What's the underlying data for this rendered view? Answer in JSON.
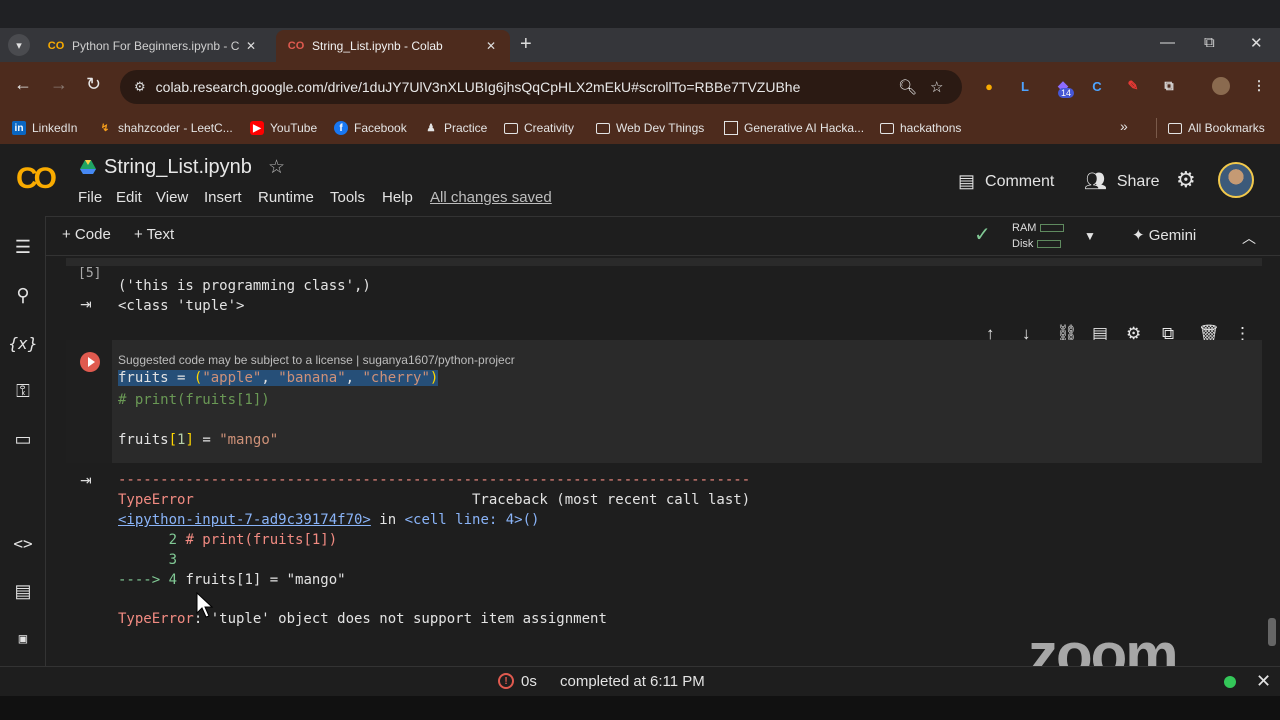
{
  "browser": {
    "tabs": [
      {
        "title": "Python For Beginners.ipynb - C",
        "active": false
      },
      {
        "title": "String_List.ipynb - Colab",
        "active": true
      }
    ],
    "new_tab": "+",
    "window_controls": {
      "minimize": "—",
      "restore": "⧉",
      "close": "✕"
    },
    "url": "colab.research.google.com/drive/1duJY7UlV3nXLUBIg6jhsQqCpHLX2mEkU#scrollTo=RBBe7TVZUBhe",
    "extensions_badge": "14",
    "bookmarks": [
      {
        "label": "LinkedIn",
        "icon": "linkedin-icon"
      },
      {
        "label": "shahzcoder - LeetC...",
        "icon": "leetcode-icon"
      },
      {
        "label": "YouTube",
        "icon": "youtube-icon"
      },
      {
        "label": "Facebook",
        "icon": "facebook-icon"
      },
      {
        "label": "Practice",
        "icon": "practice-icon"
      },
      {
        "label": "Creativity",
        "icon": "folder-icon"
      },
      {
        "label": "Web Dev Things",
        "icon": "folder-icon"
      },
      {
        "label": "Generative AI Hacka...",
        "icon": "page-icon"
      },
      {
        "label": "hackathons",
        "icon": "folder-icon"
      }
    ],
    "more_bookmarks": "»",
    "all_bookmarks": "All Bookmarks"
  },
  "colab": {
    "notebook_title": "String_List.ipynb",
    "menu": [
      "File",
      "Edit",
      "View",
      "Insert",
      "Runtime",
      "Tools",
      "Help"
    ],
    "save_status": "All changes saved",
    "comment_label": "Comment",
    "share_label": "Share",
    "toolbar": {
      "add_code": "+ Code",
      "add_text": "+ Text",
      "ram_label": "RAM",
      "disk_label": "Disk",
      "gemini_label": "Gemini"
    },
    "rail_icons": [
      "toc-icon",
      "search-icon",
      "variables-icon",
      "key-icon",
      "folder-icon",
      "code-snippets-icon",
      "command-palette-icon",
      "terminal-icon"
    ]
  },
  "cells": {
    "prev_output": {
      "exec_count": "[5]",
      "lines": [
        "('this is programming class',)",
        "<class 'tuple'>"
      ]
    },
    "active_cell": {
      "license_notice": "Suggested code may be subject to a license | suganya1607/python-projecr",
      "line1": {
        "var": "fruits",
        "op": " = ",
        "open": "(",
        "s1": "\"apple\"",
        "c1": ", ",
        "s2": "\"banana\"",
        "c2": ", ",
        "s3": "\"cherry\"",
        "close": ")"
      },
      "line2": "# print(fruits[1])",
      "line4": {
        "var": "fruits",
        "open": "[",
        "idx": "1",
        "close": "]",
        "op": " = ",
        "val": "\"mango\""
      }
    },
    "error_output": {
      "dashes": "---------------------------------------------------------------------------",
      "error_name": "TypeError",
      "traceback_label": "Traceback (most recent call last)",
      "link": "<ipython-input-7-ad9c39174f70>",
      "in_text": " in ",
      "cell_ref": "<cell line: 4>()",
      "tb_line2_num": "      2 ",
      "tb_line2_code": "# print(fruits[1])",
      "tb_line3": "      3",
      "tb_arrow": "----> 4 ",
      "tb_line4_code": "fruits[1] = \"mango\"",
      "final_error_name": "TypeError",
      "final_error_msg": ": 'tuple' object does not support item assignment"
    }
  },
  "status_bar": {
    "duration": "0s",
    "completed": "completed at 6:11 PM"
  },
  "overlay": {
    "zoom_watermark": "zoom"
  }
}
